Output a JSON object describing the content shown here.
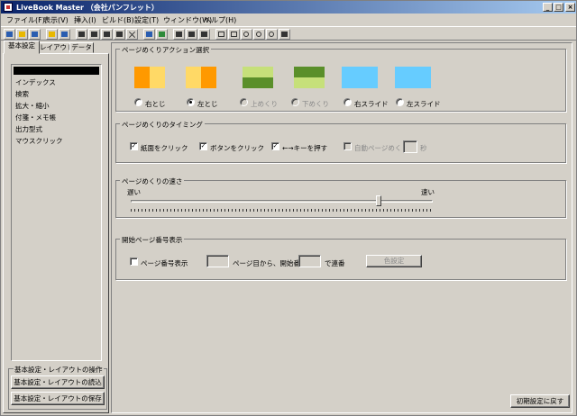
{
  "window": {
    "title": "LiveBook Master （会社パンフレット）",
    "minimize_glyph": "_",
    "maximize_glyph": "□",
    "close_glyph": "×"
  },
  "menu": {
    "file": "ファイル(F)",
    "view": "表示(V)",
    "insert": "挿入(I)",
    "build": "ビルド(B)",
    "settings": "設定(T)",
    "window": "ウィンドウ(W)",
    "help": "ヘルプ(H)"
  },
  "tabs": {
    "basic": "基本設定",
    "layout": "レイアウト",
    "data": "データ"
  },
  "sidebar": {
    "items": [
      "インデックス",
      "検索",
      "拡大・縮小",
      "付箋・メモ帳",
      "出力型式",
      "マウスクリック"
    ],
    "ops_group_title": "基本設定・レイアウトの操作",
    "load_button": "基本設定・レイアウトの読込",
    "save_button": "基本設定・レイアウトの保存"
  },
  "page_flip_action": {
    "title": "ページめくりアクション選択",
    "options": [
      "右とじ",
      "左とじ",
      "上めくり",
      "下めくり",
      "右スライド",
      "左スライド"
    ],
    "selected": "左とじ",
    "disabled": [
      "上めくり",
      "下めくり"
    ],
    "colors": {
      "orange": "#ff9900",
      "yellow": "#ffd966",
      "light_green": "#c6e07a",
      "dark_green": "#5a8f2a",
      "sky_blue": "#66ccff"
    }
  },
  "page_flip_timing": {
    "title": "ページめくりのタイミング",
    "click_paper": "紙面をクリック",
    "click_button": "ボタンをクリック",
    "arrow_keys": "←→キーを押す",
    "auto_flip": "自動ページめくり",
    "seconds_unit": "秒",
    "seconds_value": "",
    "checked": {
      "click_paper": true,
      "click_button": true,
      "arrow_keys": true,
      "auto_flip": false
    },
    "check_glyph": "✓"
  },
  "page_flip_speed": {
    "title": "ページめくりの速さ",
    "slow_label": "遅い",
    "fast_label": "速い",
    "level": 0.82
  },
  "start_page_number": {
    "title": "開始ページ番号表示",
    "show_page_number": "ページ番号表示",
    "show_page_number_checked": false,
    "page_from_value": "",
    "from_label": "ページ目から、開始番号",
    "start_number_value": "",
    "serial_label": "で連番",
    "color_button": "色設定"
  },
  "reset_button": "初期設定に戻す"
}
